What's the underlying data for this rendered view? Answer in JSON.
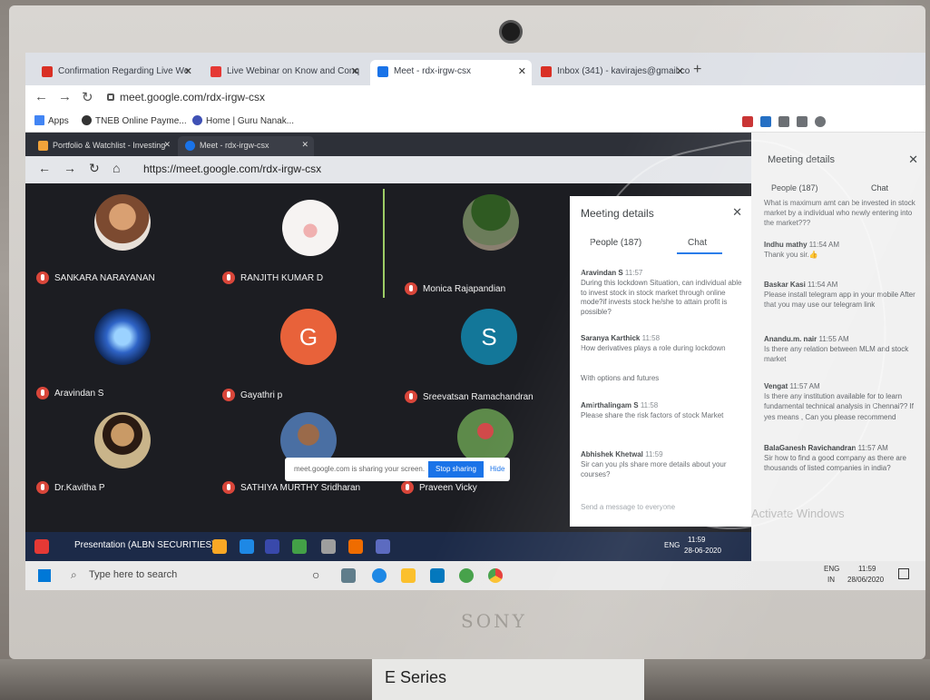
{
  "outer_browser": {
    "tabs": [
      {
        "label": "Confirmation Regarding Live We",
        "color": "#d93025"
      },
      {
        "label": "Live Webinar on Know and Conq",
        "color": "#e53935"
      },
      {
        "label": "Meet - rdx-irgw-csx",
        "color": "#1a73e8"
      },
      {
        "label": "Inbox (341) - kavirajes@gmail.co",
        "color": "#d93025"
      }
    ],
    "url": "meet.google.com/rdx-irgw-csx",
    "bookmarks": [
      "Apps",
      "TNEB Online Payme...",
      "Home | Guru Nanak..."
    ]
  },
  "inner_browser": {
    "tabs": [
      {
        "label": "Portfolio & Watchlist - Investing"
      },
      {
        "label": "Meet - rdx-irgw-csx"
      }
    ],
    "url": "https://meet.google.com/rdx-irgw-csx"
  },
  "participants": [
    {
      "name": "SANKARA NARAYANAN",
      "avatar": "photo",
      "color": "#c47a48"
    },
    {
      "name": "RANJITH KUMAR D",
      "avatar": "photo",
      "color": "#f4f1f0"
    },
    {
      "name": "Monica Rajapandian",
      "avatar": "photo",
      "color": "#4e6b3a"
    },
    {
      "name": "Aravindan S",
      "avatar": "photo",
      "color": "#2f64c7"
    },
    {
      "name": "Gayathri p",
      "avatar": "letter",
      "letter": "G",
      "color": "#e8623a"
    },
    {
      "name": "Sreevatsan Ramachandran",
      "avatar": "letter",
      "letter": "S",
      "color": "#137799"
    },
    {
      "name": "Dr.Kavitha P",
      "avatar": "photo",
      "color": "#c99a66"
    },
    {
      "name": "SATHIYA MURTHY Sridharan",
      "avatar": "photo",
      "color": "#4a6fa3"
    },
    {
      "name": "Praveen Vicky",
      "avatar": "photo",
      "color": "#5d8a4a"
    }
  ],
  "share_bar": {
    "text": "meet.google.com is sharing your screen.",
    "stop_label": "Stop sharing",
    "hide_label": "Hide"
  },
  "inner_panel": {
    "title": "Meeting details",
    "people_label": "People (187)",
    "chat_label": "Chat",
    "messages": [
      {
        "author": "Aravindan S",
        "time": "11:57",
        "text": "During this lockdown Situation, can individual able to invest stock in stock market through online mode?if invests stock he/she to attain profit is possible?"
      },
      {
        "author": "Saranya Karthick",
        "time": "11:58",
        "text": "How derivatives plays a role during lockdown"
      },
      {
        "author": "",
        "time": "",
        "text": "With options and futures"
      },
      {
        "author": "Amirthalingam S",
        "time": "11:58",
        "text": "Please share the risk factors of stock Market"
      },
      {
        "author": "Abhishek Khetwal",
        "time": "11:59",
        "text": "Sir can you pls share more details about your courses?"
      }
    ],
    "input_placeholder": "Send a message to everyone"
  },
  "outer_panel": {
    "title": "Meeting details",
    "people_label": "People (187)",
    "chat_label": "Chat",
    "messages": [
      {
        "author": "",
        "time": "",
        "text": "What is maximum amt can be invested in stock market by a individual who newly entering into the market???"
      },
      {
        "author": "Indhu mathy",
        "time": "11:54 AM",
        "text": "Thank you sir.👍"
      },
      {
        "author": "Baskar Kasi",
        "time": "11:54 AM",
        "text": "Please install telegram app in your mobile After that you may use our telegram link"
      },
      {
        "author": "Anandu.m. nair",
        "time": "11:55 AM",
        "text": "Is there any relation between MLM and stock market"
      },
      {
        "author": "Vengat",
        "time": "11:57 AM",
        "text": "Is there any institution available for to learn fundamental technical analysis in Chennai?? If yes means , Can you please recommend"
      },
      {
        "author": "BalaGanesh Ravichandran",
        "time": "11:57 AM",
        "text": "Sir how to find a good company as there are thousands of listed companies in india?"
      }
    ],
    "watermark": "Activate Windows"
  },
  "inner_taskbar": {
    "app_label": "Presentation (ALBN SECURITIES)",
    "lang": "ENG",
    "time": "11:59",
    "date": "28-06-2020"
  },
  "outer_taskbar": {
    "search_placeholder": "Type here to search",
    "lang": "ENG",
    "region": "IN",
    "time": "11:59",
    "date": "28/06/2020"
  },
  "laptop": {
    "brand": "SONY"
  },
  "sticker": {
    "series": "E Series"
  }
}
